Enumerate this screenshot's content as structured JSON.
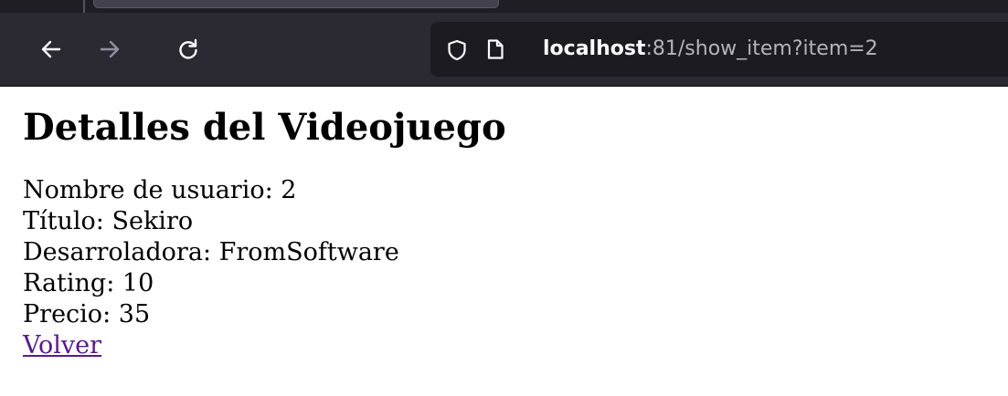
{
  "browser": {
    "url_host": "localhost",
    "url_rest": ":81/show_item?item=2",
    "icons": {
      "back": "arrow-left-icon",
      "forward": "arrow-right-icon",
      "reload": "reload-icon",
      "shield": "shield-icon",
      "page": "page-icon"
    },
    "colors": {
      "toolbar": "#2b2a33",
      "urlbar": "#1c1b22",
      "visited_link": "#551a8b"
    }
  },
  "page": {
    "title": "Detalles del Videojuego",
    "fields": [
      {
        "label": "Nombre de usuario",
        "value": "2"
      },
      {
        "label": "Título",
        "value": "Sekiro"
      },
      {
        "label": "Desarroladora",
        "value": "FromSoftware"
      },
      {
        "label": "Rating",
        "value": "10"
      },
      {
        "label": "Precio",
        "value": "35"
      }
    ],
    "back_link": "Volver"
  }
}
